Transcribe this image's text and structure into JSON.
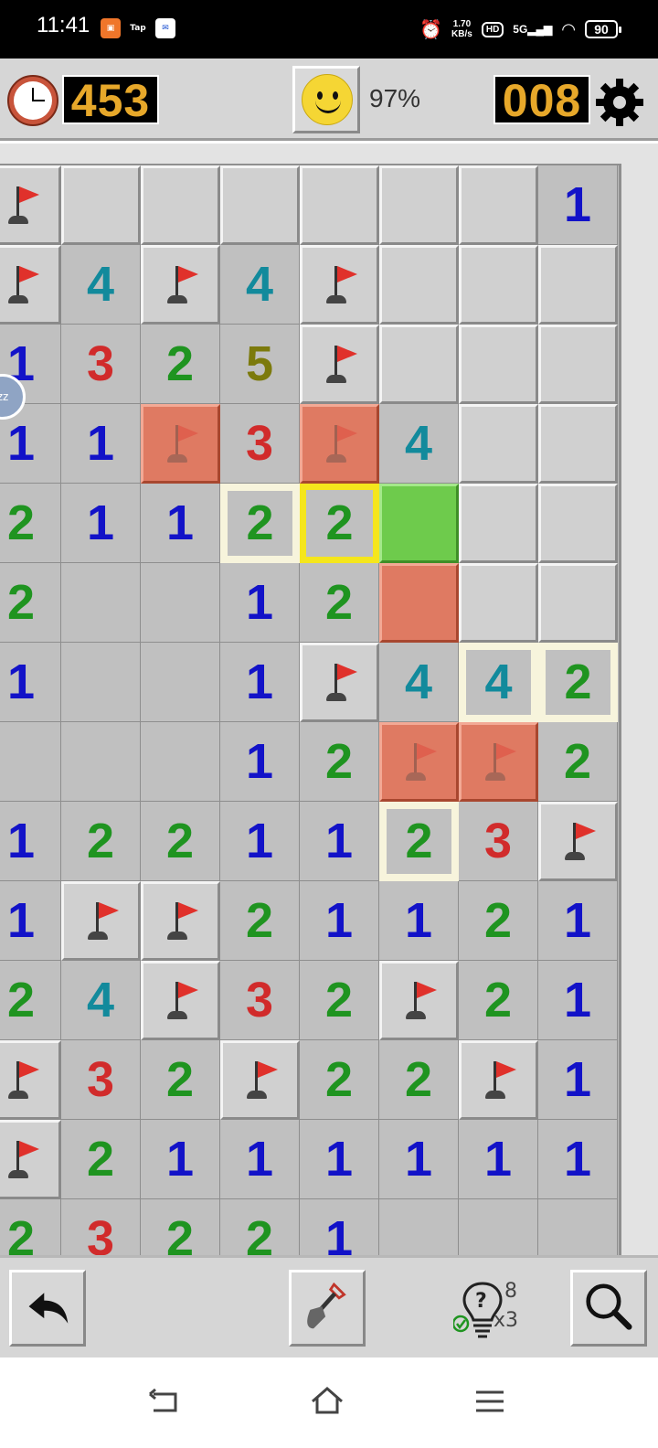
{
  "status_bar": {
    "time": "11:41",
    "app_icons": [
      "Tap",
      "Tap",
      "M"
    ],
    "net_speed_top": "1.70",
    "net_speed_bottom": "KB/s",
    "hd_label": "HD",
    "signal_label": "5G",
    "battery": "90"
  },
  "game": {
    "timer": "453",
    "progress": "97%",
    "mines_left": "008",
    "face": "smiley-happy"
  },
  "board": {
    "cols": 8,
    "legend": "F=flag, C=covered, number=opened, 0=empty, R=red highlight, G=green, H=highlight frame, Y=yellow frame",
    "rows": [
      [
        "F",
        "C",
        "C",
        "C",
        "C",
        "C",
        "C",
        "1"
      ],
      [
        "F",
        "4",
        "F",
        "4",
        "F",
        "C",
        "C",
        "C"
      ],
      [
        "1",
        "3",
        "2",
        "5",
        "F",
        "C",
        "C",
        "C"
      ],
      [
        "1",
        "1",
        "RF",
        "3",
        "RF",
        "4",
        "C",
        "C"
      ],
      [
        "2",
        "1",
        "1",
        "H2",
        "Y2",
        "G",
        "C",
        "C"
      ],
      [
        "2",
        "0",
        "0",
        "1",
        "2",
        "R",
        "C",
        "C"
      ],
      [
        "1",
        "0",
        "0",
        "1",
        "F",
        "4",
        "H4",
        "H2"
      ],
      [
        "0",
        "0",
        "0",
        "1",
        "2",
        "RF",
        "RF",
        "2"
      ],
      [
        "1",
        "2",
        "2",
        "1",
        "1",
        "H2",
        "3",
        "F"
      ],
      [
        "1",
        "F",
        "F",
        "2",
        "1",
        "1",
        "2",
        "1"
      ],
      [
        "2",
        "4",
        "F",
        "3",
        "2",
        "F",
        "2",
        "1"
      ],
      [
        "F",
        "3",
        "2",
        "F",
        "2",
        "2",
        "F",
        "1"
      ],
      [
        "F",
        "2",
        "1",
        "1",
        "1",
        "1",
        "1",
        "1"
      ],
      [
        "2",
        "3",
        "2",
        "2",
        "1",
        "0",
        "0",
        "0"
      ]
    ]
  },
  "toolbar": {
    "hints_available": "8",
    "hints_used": "x3"
  },
  "colors": {
    "lcd_digits": "#e7a82a",
    "flag": "#e0312b",
    "n1": "#1212c8",
    "n2": "#1f9420",
    "n3": "#d12b2b",
    "n4": "#128a9c",
    "n5": "#7c7a0c"
  }
}
